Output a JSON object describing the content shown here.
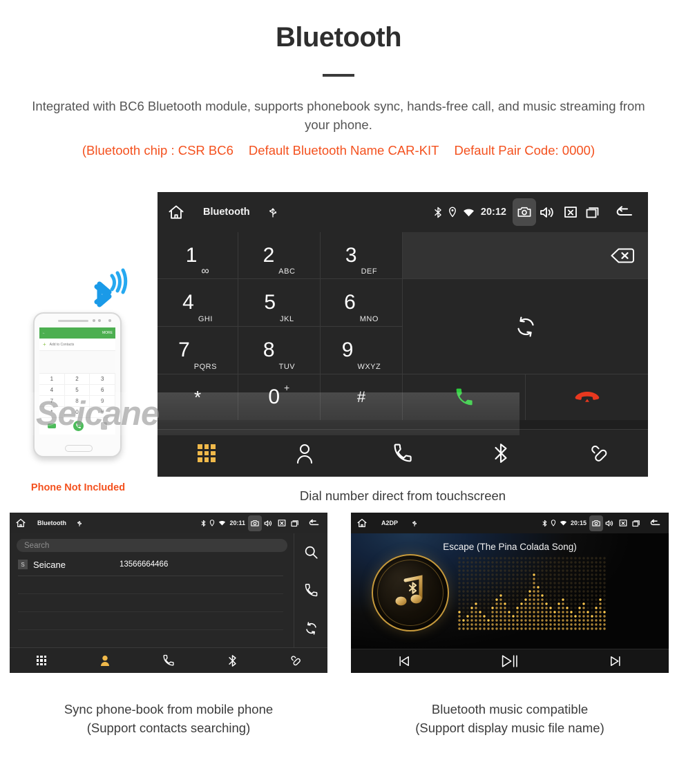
{
  "header": {
    "title": "Bluetooth",
    "description": "Integrated with BC6 Bluetooth module, supports phonebook sync, hands-free call, and music streaming from your phone.",
    "red_note_1": "(Bluetooth chip : CSR BC6",
    "red_note_2": "Default Bluetooth Name CAR-KIT",
    "red_note_3": "Default Pair Code: 0000)",
    "accent_color": "#f4511e"
  },
  "dialer": {
    "status_bar": {
      "title": "Bluetooth",
      "time": "20:12",
      "icons": [
        "home-icon",
        "usb-icon",
        "bluetooth-icon",
        "location-icon",
        "wifi-icon",
        "camera-icon",
        "volume-icon",
        "close-box-icon",
        "recent-apps-icon",
        "back-icon"
      ]
    },
    "keys": [
      {
        "num": "1",
        "sub": "∞"
      },
      {
        "num": "2",
        "sub": "ABC"
      },
      {
        "num": "3",
        "sub": "DEF"
      },
      {
        "num": "4",
        "sub": "GHI"
      },
      {
        "num": "5",
        "sub": "JKL"
      },
      {
        "num": "6",
        "sub": "MNO"
      },
      {
        "num": "7",
        "sub": "PQRS"
      },
      {
        "num": "8",
        "sub": "TUV"
      },
      {
        "num": "9",
        "sub": "WXYZ"
      },
      {
        "num": "*",
        "sub": ""
      },
      {
        "num": "0",
        "sub": "+"
      },
      {
        "num": "#",
        "sub": ""
      }
    ],
    "number_input_value": "",
    "call_button": "call-button",
    "hangup_button": "hangup-button",
    "nav": [
      "keypad-icon",
      "contacts-icon",
      "call-log-icon",
      "bluetooth-icon",
      "pair-link-icon"
    ],
    "active_nav": "keypad-icon",
    "active_nav_color": "#f0b94a",
    "call_color": "#2ecc3d",
    "hangup_color": "#e8381f",
    "caption": "Dial number direct from touchscreen"
  },
  "phone_mockup": {
    "screen_title": "MORE",
    "back_arrow": "←",
    "add_to_contacts": "Add to Contacts",
    "keys": [
      "1",
      "2",
      "3",
      "4",
      "5",
      "6",
      "7",
      "8",
      "9",
      "*",
      "0",
      "#"
    ],
    "not_included_note": "Phone Not Included"
  },
  "watermark": {
    "text": "Seicane"
  },
  "phonebook": {
    "status_bar": {
      "title": "Bluetooth",
      "time": "20:11"
    },
    "search_placeholder": "Search",
    "contacts": [
      {
        "initial": "S",
        "name": "Seicane",
        "number": "13566664466"
      }
    ],
    "siderail": [
      "search-icon",
      "call-icon",
      "sync-icon"
    ],
    "nav": [
      "keypad-icon",
      "contacts-icon",
      "call-log-icon",
      "bluetooth-icon",
      "pair-link-icon"
    ],
    "active_nav": "contacts-icon",
    "caption_line1": "Sync phone-book from mobile phone",
    "caption_line2": "(Support contacts searching)"
  },
  "music": {
    "status_bar": {
      "title": "A2DP",
      "time": "20:15"
    },
    "song_title": "Escape (The Pina Colada Song)",
    "controls": [
      "previous-icon",
      "play-pause-icon",
      "next-icon"
    ],
    "accent_color": "#c79a3c",
    "caption_line1": "Bluetooth music compatible",
    "caption_line2": "(Support display music file name)"
  }
}
